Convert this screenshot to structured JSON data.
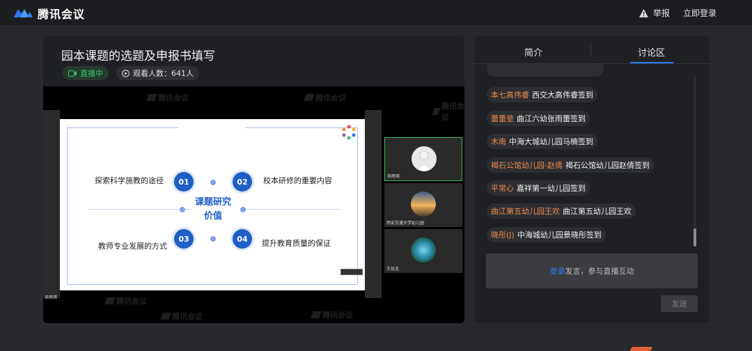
{
  "header": {
    "app_name": "腾讯会议",
    "report_label": "举报",
    "login_label": "立即登录"
  },
  "stream": {
    "title": "园本课题的选题及申报书填写",
    "live_label": "直播中",
    "viewers_label": "观看人数：641人",
    "watermark_text": "腾讯会议"
  },
  "slide": {
    "center_title": "课题研究",
    "center_subtitle": "价值",
    "items": [
      {
        "num": "01",
        "label": "探索科学施教的途径"
      },
      {
        "num": "02",
        "label": "校本研修的重要内容"
      },
      {
        "num": "03",
        "label": "教师专业发展的方式"
      },
      {
        "num": "04",
        "label": "提升教育质量的保证"
      }
    ]
  },
  "thumbnails": [
    {
      "name": "吴雨琪"
    },
    {
      "name": "西安交通大学幼儿园"
    },
    {
      "name": "王优北"
    }
  ],
  "main_speaker_name": "吴雨琪",
  "sidebar": {
    "tabs": [
      {
        "label": "简介"
      },
      {
        "label": "讨论区"
      }
    ],
    "active_tab": "讨论区",
    "messages": [
      {
        "nick": "本七高伟睿",
        "text": "西交大高伟睿签到"
      },
      {
        "nick": "蕾蕾垒",
        "text": "曲江六幼张雨蕾签到"
      },
      {
        "nick": "木南",
        "text": "中海大城幼儿园马楠签到"
      },
      {
        "nick": "褐石公馆幼儿园-赵倩",
        "text": "褐石公馆幼儿园赵倩签到"
      },
      {
        "nick": "平常心",
        "text": "嘉祥第一幼儿园签到"
      },
      {
        "nick": "曲江第五幼儿园王欢",
        "text": "曲江第五幼儿园王欢"
      },
      {
        "nick": "晓彤(J)",
        "text": "中海城幼儿园景晓彤签到"
      }
    ],
    "input": {
      "login_link": "登录",
      "prompt": "发言，参与直播互动"
    },
    "send_label": "发送"
  },
  "colors": {
    "accent_blue": "#2f7cf6",
    "live_green": "#35c46d",
    "nick_orange": "#f08a4b",
    "slide_blue": "#1e5fc6"
  }
}
